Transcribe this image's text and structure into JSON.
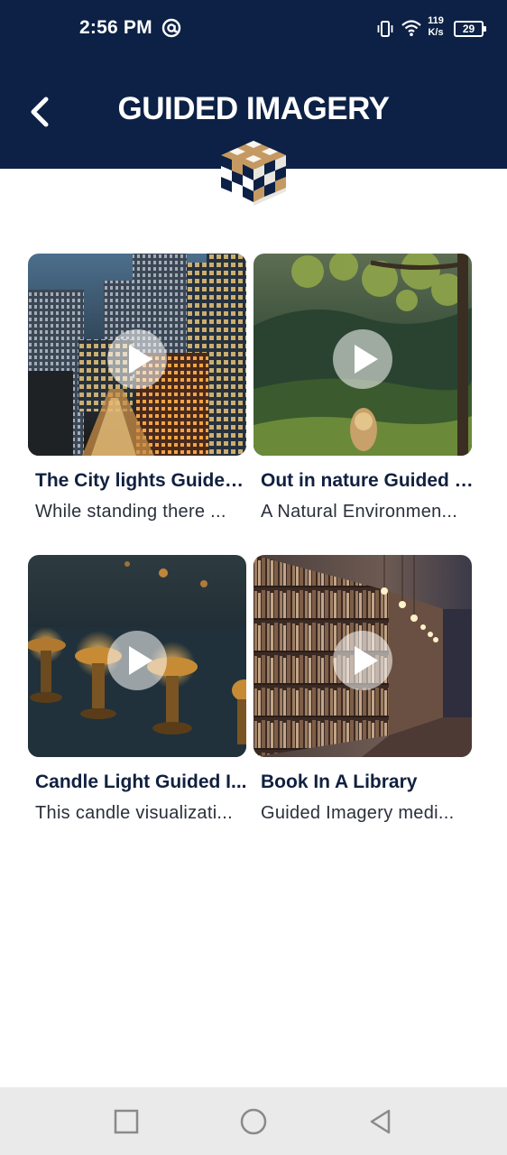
{
  "status_bar": {
    "time": "2:56 PM",
    "net_speed_value": "119",
    "net_speed_unit": "K/s",
    "battery": "29"
  },
  "header": {
    "title": "GUIDED IMAGERY",
    "back_icon": "chevron-left-icon"
  },
  "cards": [
    {
      "title": "The City lights Guided...",
      "description": "While standing there ...",
      "image": "city-night-skyline"
    },
    {
      "title": "Out in nature Guided I...",
      "description": "A Natural Environmen...",
      "image": "forest-woman-view"
    },
    {
      "title": "Candle Light Guided I...",
      "description": "This candle visualizati...",
      "image": "candles-table"
    },
    {
      "title": "Book In A Library",
      "description": "Guided Imagery medi...",
      "image": "library-bookshelves"
    }
  ],
  "nav_bar": {
    "recents_icon": "square-icon",
    "home_icon": "circle-icon",
    "back_icon": "triangle-back-icon"
  },
  "colors": {
    "header_bg": "#0c2145",
    "title_text": "#10203f",
    "nav_bg": "#eaeaea"
  }
}
